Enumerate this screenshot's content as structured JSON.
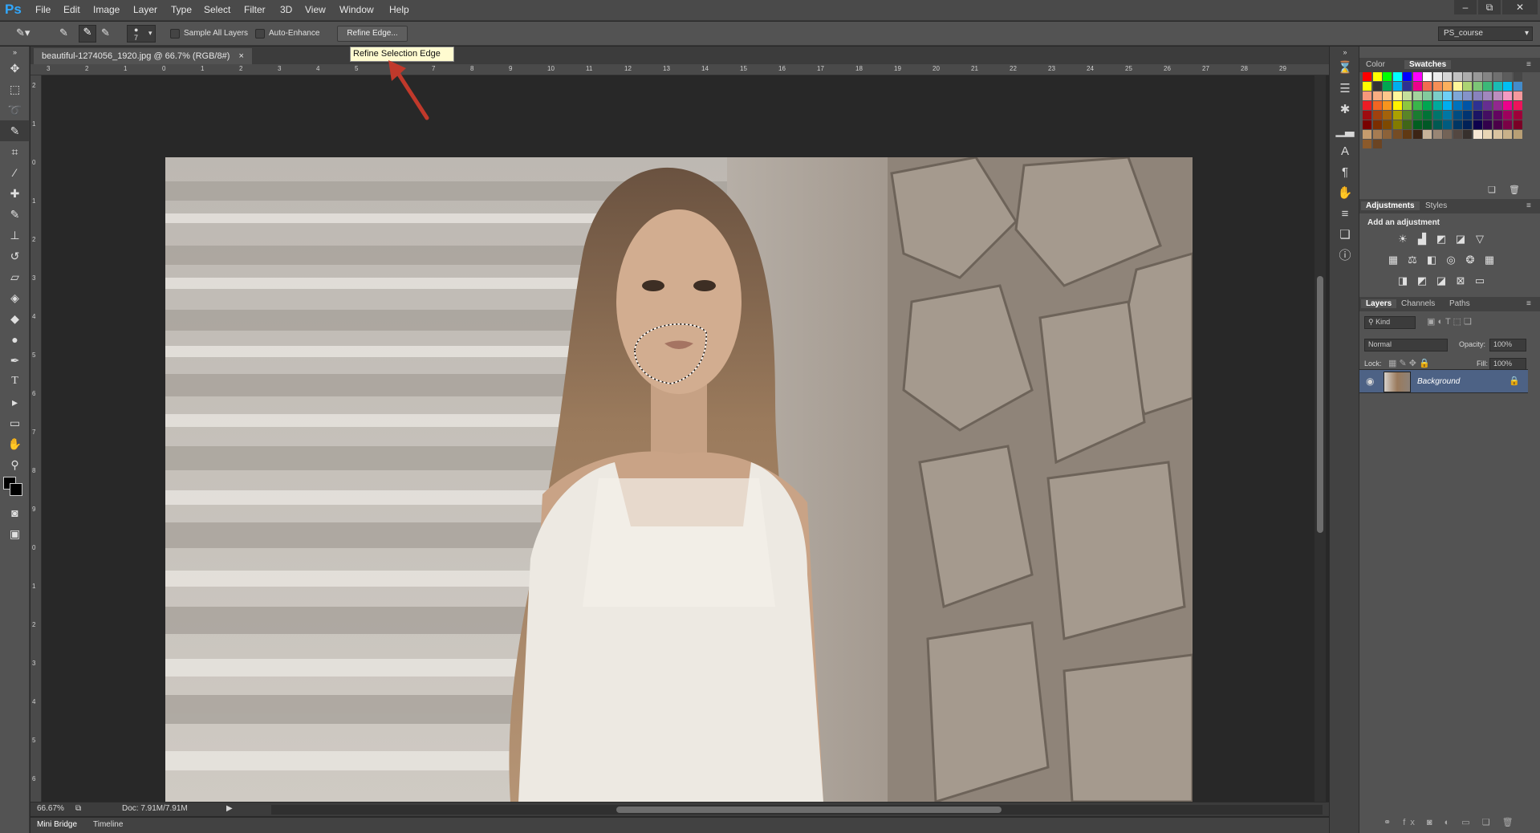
{
  "app": {
    "logo": "Ps"
  },
  "menus": [
    "File",
    "Edit",
    "Image",
    "Layer",
    "Type",
    "Select",
    "Filter",
    "3D",
    "View",
    "Window",
    "Help"
  ],
  "window_controls": [
    "–",
    "⧉",
    "✕"
  ],
  "options": {
    "brush_size": "7",
    "sample_all_layers": "Sample All Layers",
    "auto_enhance": "Auto-Enhance",
    "refine_edge": "Refine Edge...",
    "workspace": "PS_course"
  },
  "tooltip": "Refine Selection Edge",
  "document": {
    "tab_title": "beautiful-1274056_1920.jpg @ 66.7% (RGB/8#)",
    "tab_close": "×"
  },
  "ruler": {
    "top": [
      "3",
      "2",
      "1",
      "0",
      "1",
      "2",
      "3",
      "4",
      "5",
      "6",
      "7",
      "8",
      "9",
      "10",
      "11",
      "12",
      "13",
      "14",
      "15",
      "16",
      "17",
      "18",
      "19",
      "20",
      "21",
      "22",
      "23",
      "24",
      "25",
      "26",
      "27",
      "28",
      "29"
    ],
    "left": [
      "2",
      "1",
      "0",
      "1",
      "2",
      "3",
      "4",
      "5",
      "6",
      "7",
      "8",
      "9",
      "0",
      "1",
      "2",
      "3",
      "4",
      "5",
      "6"
    ]
  },
  "status": {
    "zoom": "66.67%",
    "doc": "Doc: 7.91M/7.91M"
  },
  "bottom_tabs": [
    "Mini Bridge",
    "Timeline"
  ],
  "panels": {
    "color_tabs": [
      "Color",
      "Swatches"
    ],
    "adjust_tabs": [
      "Adjustments",
      "Styles"
    ],
    "adjust_title": "Add an adjustment",
    "layers_tabs": [
      "Layers",
      "Channels",
      "Paths"
    ],
    "kind": "Kind",
    "blend_mode": "Normal",
    "opacity_label": "Opacity:",
    "opacity_value": "100%",
    "lock_label": "Lock:",
    "fill_label": "Fill:",
    "fill_value": "100%",
    "layer_name": "Background"
  },
  "colors": {
    "accent": "#31a8ff",
    "selected_layer": "#4d6285"
  }
}
